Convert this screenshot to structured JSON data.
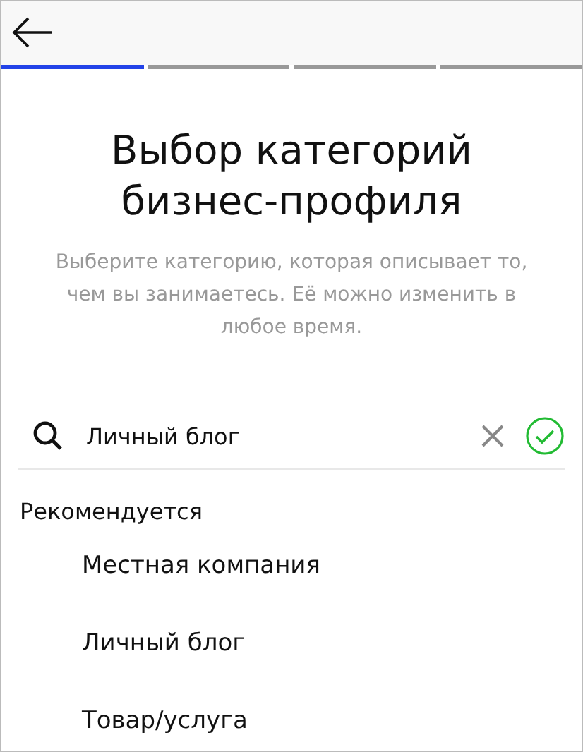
{
  "progress_steps": [
    {
      "active": true
    },
    {
      "active": false
    },
    {
      "active": false
    },
    {
      "active": false
    }
  ],
  "title": "Выбор категорий бизнес-профиля",
  "subtitle": "Выберите категорию, которая описывает то, чем вы занимаетесь. Её можно изменить в любое время.",
  "search": {
    "value": "Личный блог",
    "confirmed": true
  },
  "section_label": "Рекомендуется",
  "categories": [
    {
      "label": "Местная компания"
    },
    {
      "label": "Личный блог"
    },
    {
      "label": "Товар/услуга"
    }
  ]
}
